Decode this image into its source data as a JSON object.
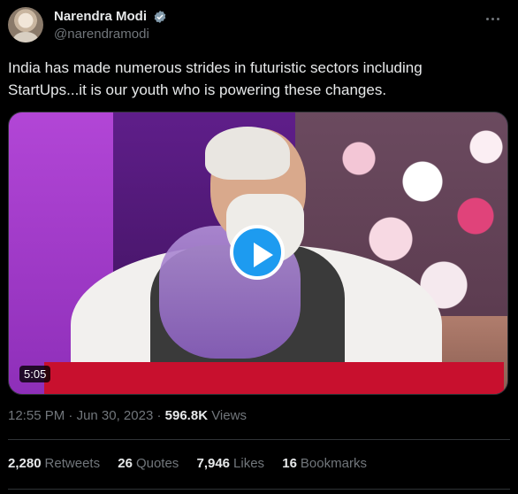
{
  "author": {
    "name": "Narendra Modi",
    "handle": "@narendramodi",
    "verified": true
  },
  "tweet": {
    "text": "India has made numerous strides in futuristic sectors including StartUps...it is our youth who is powering these changes."
  },
  "video": {
    "duration": "5:05"
  },
  "meta": {
    "time": "12:55 PM",
    "separator1": " · ",
    "date": "Jun 30, 2023",
    "separator2": " · ",
    "views_count": "596.8K",
    "views_label": "Views"
  },
  "stats": [
    {
      "count": "2,280",
      "label": "Retweets"
    },
    {
      "count": "26",
      "label": "Quotes"
    },
    {
      "count": "7,946",
      "label": "Likes"
    },
    {
      "count": "16",
      "label": "Bookmarks"
    }
  ],
  "colors": {
    "background": "#000000",
    "text_primary": "#e7e9ea",
    "text_secondary": "#71767b",
    "accent": "#1d9bf0",
    "divider": "#2f3336"
  },
  "icons": {
    "verified": "verified-badge-icon",
    "more": "more-options-icon",
    "play": "play-icon"
  }
}
